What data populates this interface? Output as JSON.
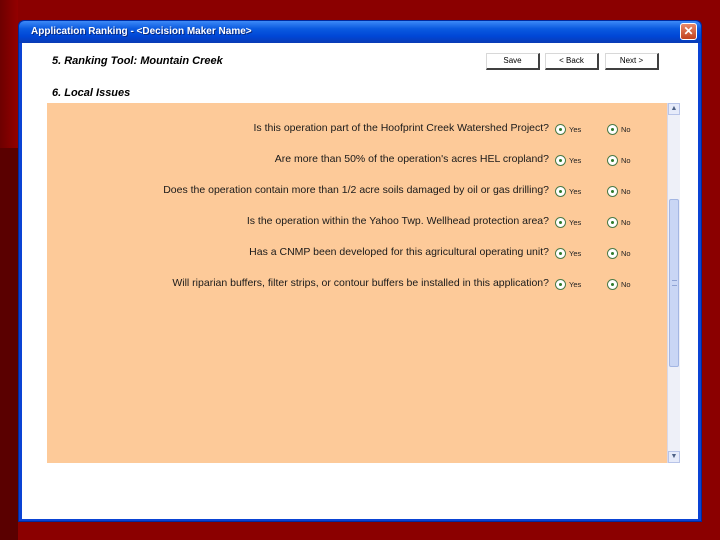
{
  "window": {
    "title": "Application Ranking - <Decision Maker Name>",
    "close_glyph": "✕",
    "close_icon": "close-icon"
  },
  "header": {
    "ranking_title": "5. Ranking Tool: Mountain Creek",
    "local_title": "6. Local Issues"
  },
  "buttons": {
    "save_label": "Save",
    "back_label": "< Back",
    "next_label": "Next >"
  },
  "questions": [
    {
      "text": "Is this operation part of the Hoofprint Creek Watershed Project?",
      "yes_label": "Yes",
      "no_label": "No"
    },
    {
      "text": "Are more than 50% of the operation's acres HEL cropland?",
      "yes_label": "Yes",
      "no_label": "No"
    },
    {
      "text": "Does the operation contain more than 1/2 acre soils damaged by oil or gas drilling?",
      "yes_label": "Yes",
      "no_label": "No"
    },
    {
      "text": "Is the operation within the Yahoo Twp. Wellhead protection area?",
      "yes_label": "Yes",
      "no_label": "No"
    },
    {
      "text": "Has a CNMP been developed for this agricultural operating unit?",
      "yes_label": "Yes",
      "no_label": "No"
    },
    {
      "text": "Will riparian buffers, filter strips, or contour buffers be installed in this application?",
      "yes_label": "Yes",
      "no_label": "No"
    }
  ],
  "scrollbar": {
    "up_glyph": "▲",
    "down_glyph": "▼"
  },
  "colors": {
    "panel_background": "#fdca99",
    "desktop_background": "#8b0000",
    "titlebar": "#0a5ae0"
  }
}
